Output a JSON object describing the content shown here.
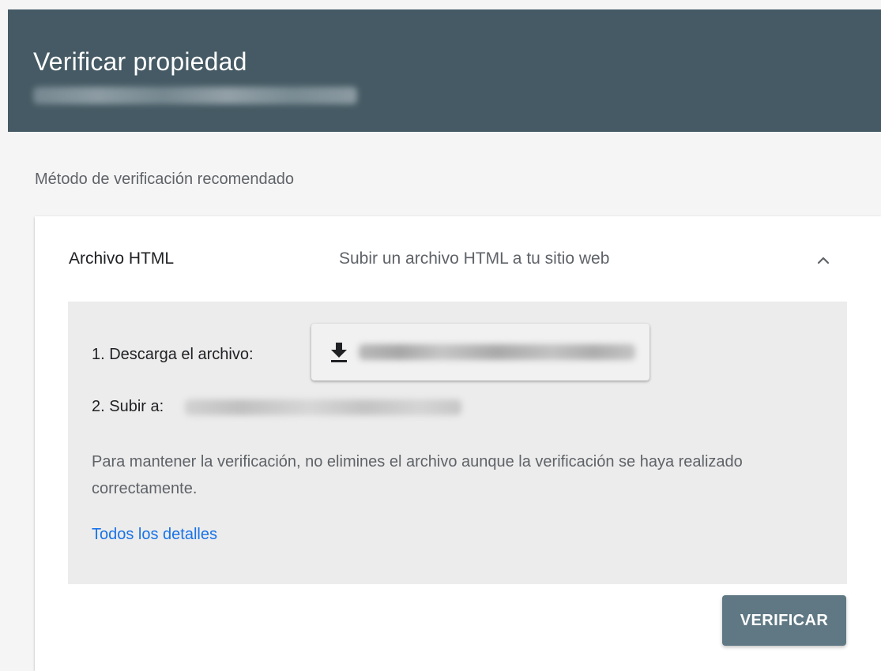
{
  "dialog": {
    "title": "Verificar propiedad",
    "header_color": "#455a64"
  },
  "section": {
    "label": "Método de verificación recomendado"
  },
  "method": {
    "name": "Archivo HTML",
    "description": "Subir un archivo HTML a tu sitio web",
    "expanded": true,
    "collapse_icon": "chevron-up-icon",
    "steps": {
      "download_label": "1. Descarga el archivo:",
      "download_icon": "download-icon",
      "upload_label": "2. Subir a:"
    },
    "note": "Para mantener la verificación, no elimines el archivo aunque la verificación se haya realizado correctamente.",
    "details_link": "Todos los detalles"
  },
  "actions": {
    "verify_label": "VERIFICAR",
    "verify_color": "#5f7884",
    "link_color": "#1a73e8"
  }
}
